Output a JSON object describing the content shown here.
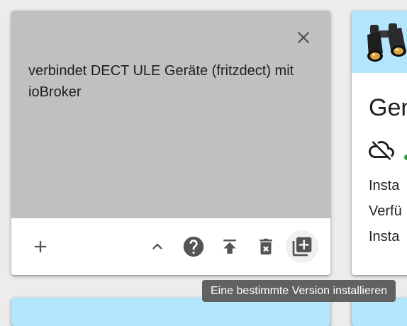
{
  "adapter_card": {
    "description": "verbindet DECT ULE Geräte (fritzdect) mit ioBroker",
    "actions": {
      "add": "add-icon",
      "collapse": "chevron-up-icon",
      "help": "help-icon",
      "upload": "upload-icon",
      "delete": "delete-icon",
      "install_version": "library-add-icon"
    }
  },
  "right_card": {
    "title": "Gen",
    "lines": [
      "Insta",
      "Verfü",
      "Insta"
    ]
  },
  "tooltip": {
    "text": "Eine bestimmte Version installieren"
  },
  "colors": {
    "description_bg": "#c0c0c0",
    "header_bg": "#b3e5fc",
    "icon": "#555555",
    "tooltip_bg": "#616161",
    "status_dot": "#2e9e3e"
  }
}
